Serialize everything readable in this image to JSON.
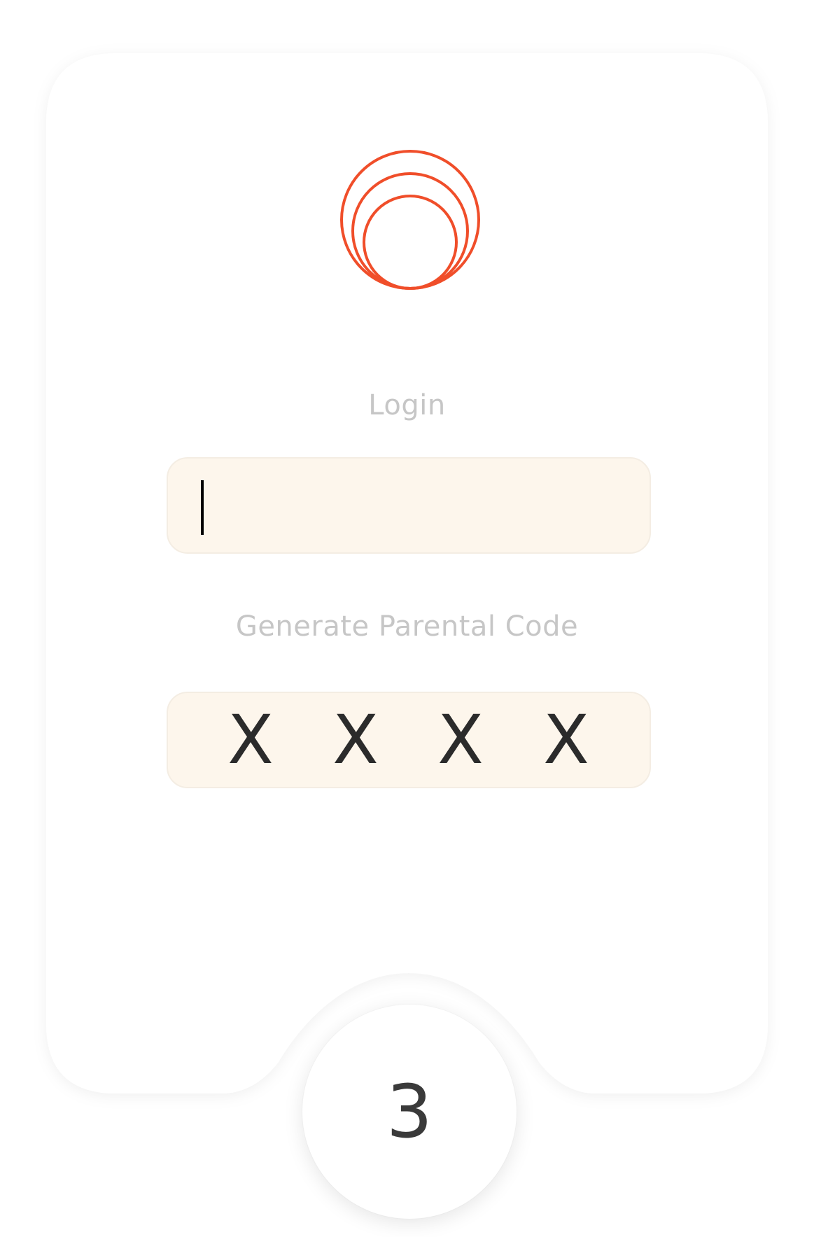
{
  "login": {
    "label": "Login",
    "value": "",
    "placeholder": ""
  },
  "parental_code": {
    "label": "Generate Parental Code",
    "chars": [
      "X",
      "X",
      "X",
      "X"
    ]
  },
  "step": {
    "number": "3"
  },
  "logo": {
    "icon": "concentric-circles-logo-icon",
    "color": "#f04e2a"
  },
  "colors": {
    "field_background": "#fdf6ec",
    "label": "#c6c6c6",
    "card": "#ffffff"
  }
}
